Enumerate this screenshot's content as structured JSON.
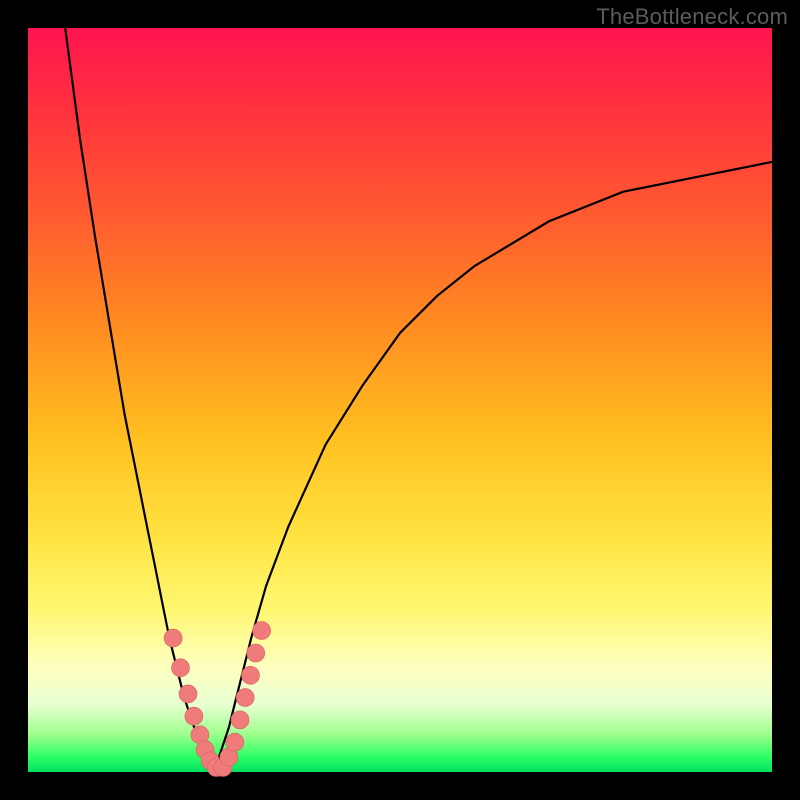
{
  "watermark": "TheBottleneck.com",
  "chart_data": {
    "type": "line",
    "title": "",
    "xlabel": "",
    "ylabel": "",
    "xlim": [
      0,
      100
    ],
    "ylim": [
      0,
      100
    ],
    "grid": false,
    "legend": false,
    "series": [
      {
        "name": "left-curve",
        "x": [
          5,
          7,
          9,
          11,
          13,
          15,
          16,
          17,
          18,
          19,
          20,
          21,
          22,
          23,
          24,
          25
        ],
        "y": [
          100,
          85,
          72,
          60,
          48,
          38,
          33,
          28,
          23,
          18,
          14,
          10,
          7,
          4,
          2,
          0
        ]
      },
      {
        "name": "right-curve",
        "x": [
          25,
          26,
          27,
          28,
          29,
          30,
          32,
          35,
          40,
          45,
          50,
          55,
          60,
          70,
          80,
          90,
          100
        ],
        "y": [
          0,
          3,
          6,
          10,
          14,
          18,
          25,
          33,
          44,
          52,
          59,
          64,
          68,
          74,
          78,
          80,
          82
        ]
      }
    ],
    "points": {
      "name": "sample-dots",
      "coords": [
        [
          19.5,
          18
        ],
        [
          20.5,
          14
        ],
        [
          21.5,
          10.5
        ],
        [
          22.3,
          7.5
        ],
        [
          23.1,
          5
        ],
        [
          23.8,
          3
        ],
        [
          24.5,
          1.5
        ],
        [
          25.3,
          0.6
        ],
        [
          26.2,
          0.6
        ],
        [
          27.0,
          2
        ],
        [
          27.8,
          4
        ],
        [
          28.5,
          7
        ],
        [
          29.2,
          10
        ],
        [
          29.9,
          13
        ],
        [
          30.6,
          16
        ],
        [
          31.4,
          19
        ]
      ]
    },
    "gradient_stops": [
      {
        "pos": 0,
        "color": "#ff1450"
      },
      {
        "pos": 25,
        "color": "#ff5a30"
      },
      {
        "pos": 55,
        "color": "#ffbf20"
      },
      {
        "pos": 78,
        "color": "#fff770"
      },
      {
        "pos": 95,
        "color": "#9cff8c"
      },
      {
        "pos": 100,
        "color": "#00e060"
      }
    ]
  }
}
